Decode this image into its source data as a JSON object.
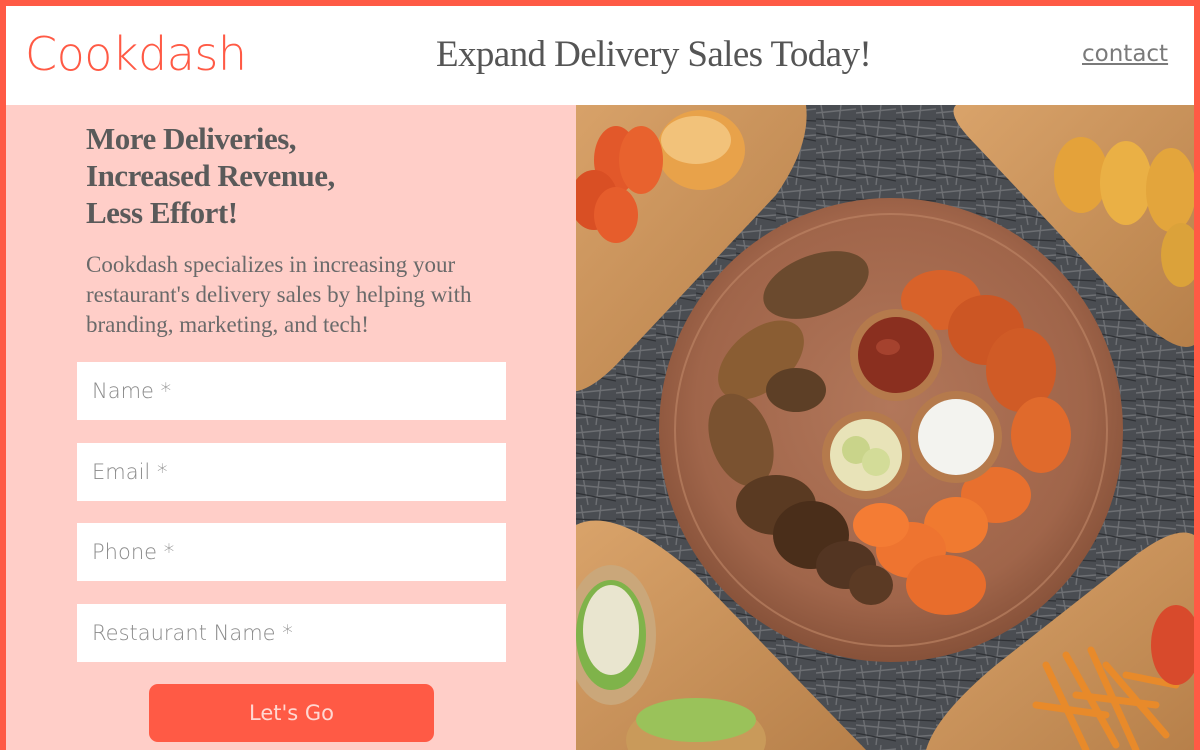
{
  "header": {
    "logo": "Cookdash",
    "headline": "Expand Delivery Sales Today!",
    "contact_link": "contact"
  },
  "hero": {
    "title_lines": [
      "More Deliveries,",
      "Increased Revenue,",
      "Less Effort!"
    ],
    "description": "Cookdash specializes in increasing your restaurant's delivery sales by helping with branding, marketing, and tech!"
  },
  "form": {
    "name_placeholder": "Name *",
    "email_placeholder": "Email *",
    "phone_placeholder": "Phone *",
    "restaurant_placeholder": "Restaurant Name *",
    "submit_label": "Let's Go"
  },
  "colors": {
    "brand": "#ff5a45",
    "panel_bg": "#ffcec8",
    "text_gray": "#5a5a5a"
  },
  "image": {
    "subject": "food-platter-photo"
  }
}
